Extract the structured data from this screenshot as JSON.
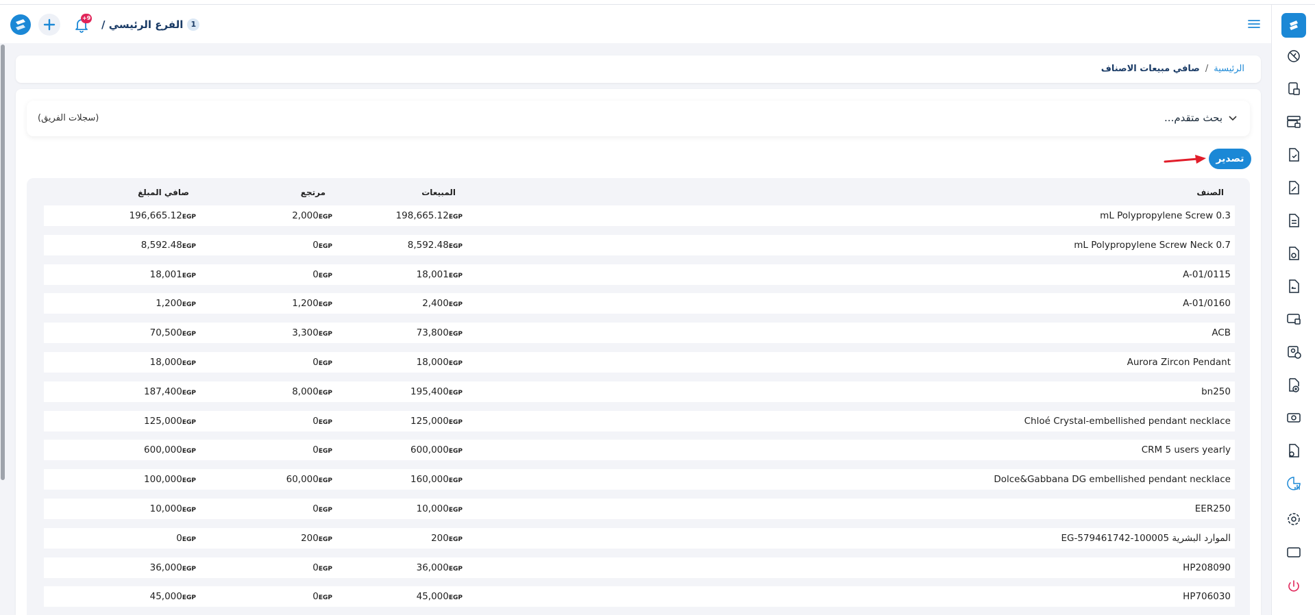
{
  "header": {
    "branch_number": "1",
    "branch_name": "الفرع الرئيسي /",
    "notification_count": "+9"
  },
  "breadcrumb": {
    "home": "الرئيسية",
    "separator": "/",
    "current": "صافي مبيعات الاصناف"
  },
  "search": {
    "advanced_label": "بحث متقدم...",
    "team_records": "(سجلات الفريق)"
  },
  "export_label": "تصدير",
  "table": {
    "headers": {
      "item": "الصنف",
      "sales": "المبيعات",
      "returns": "مرتجع",
      "net": "صافي المبلغ"
    },
    "currency": "EGP",
    "rows": [
      {
        "item": "mL Polypropylene Screw 0.3",
        "sales": "198,665.12",
        "returns": "2,000",
        "net": "196,665.12"
      },
      {
        "item": "mL Polypropylene Screw Neck 0.7",
        "sales": "8,592.48",
        "returns": "0",
        "net": "8,592.48"
      },
      {
        "item": "A-01/0115",
        "sales": "18,001",
        "returns": "0",
        "net": "18,001"
      },
      {
        "item": "A-01/0160",
        "sales": "2,400",
        "returns": "1,200",
        "net": "1,200"
      },
      {
        "item": "ACB",
        "sales": "73,800",
        "returns": "3,300",
        "net": "70,500"
      },
      {
        "item": "Aurora Zircon Pendant",
        "sales": "18,000",
        "returns": "0",
        "net": "18,000"
      },
      {
        "item": "bn250",
        "sales": "195,400",
        "returns": "8,000",
        "net": "187,400"
      },
      {
        "item": "Chloé Crystal-embellished pendant necklace",
        "sales": "125,000",
        "returns": "0",
        "net": "125,000"
      },
      {
        "item": "CRM 5 users yearly",
        "sales": "600,000",
        "returns": "0",
        "net": "600,000"
      },
      {
        "item": "Dolce&Gabbana DG embellished pendant necklace",
        "sales": "160,000",
        "returns": "60,000",
        "net": "100,000"
      },
      {
        "item": "EER250",
        "sales": "10,000",
        "returns": "0",
        "net": "10,000"
      },
      {
        "item": "EG-579461742-100005 الموارد البشرية",
        "sales": "200",
        "returns": "200",
        "net": "0"
      },
      {
        "item": "HP208090",
        "sales": "36,000",
        "returns": "0",
        "net": "36,000"
      },
      {
        "item": "HP706030",
        "sales": "45,000",
        "returns": "0",
        "net": "45,000"
      }
    ]
  },
  "sidebar_icons": [
    "dashboard-icon",
    "pos-icon",
    "register-icon",
    "invoice-icon",
    "sales-doc-icon",
    "document-icon",
    "purchase-doc-icon",
    "returns-doc-icon",
    "screen-icon",
    "customer-add-icon",
    "doc-add-icon",
    "money-icon",
    "user-doc-icon",
    "reports-chart-icon",
    "gear-icon",
    "window-icon",
    "power-icon"
  ],
  "colors": {
    "accent": "#1b88d6",
    "badge": "#e0265a",
    "logout": "#e0265a"
  }
}
